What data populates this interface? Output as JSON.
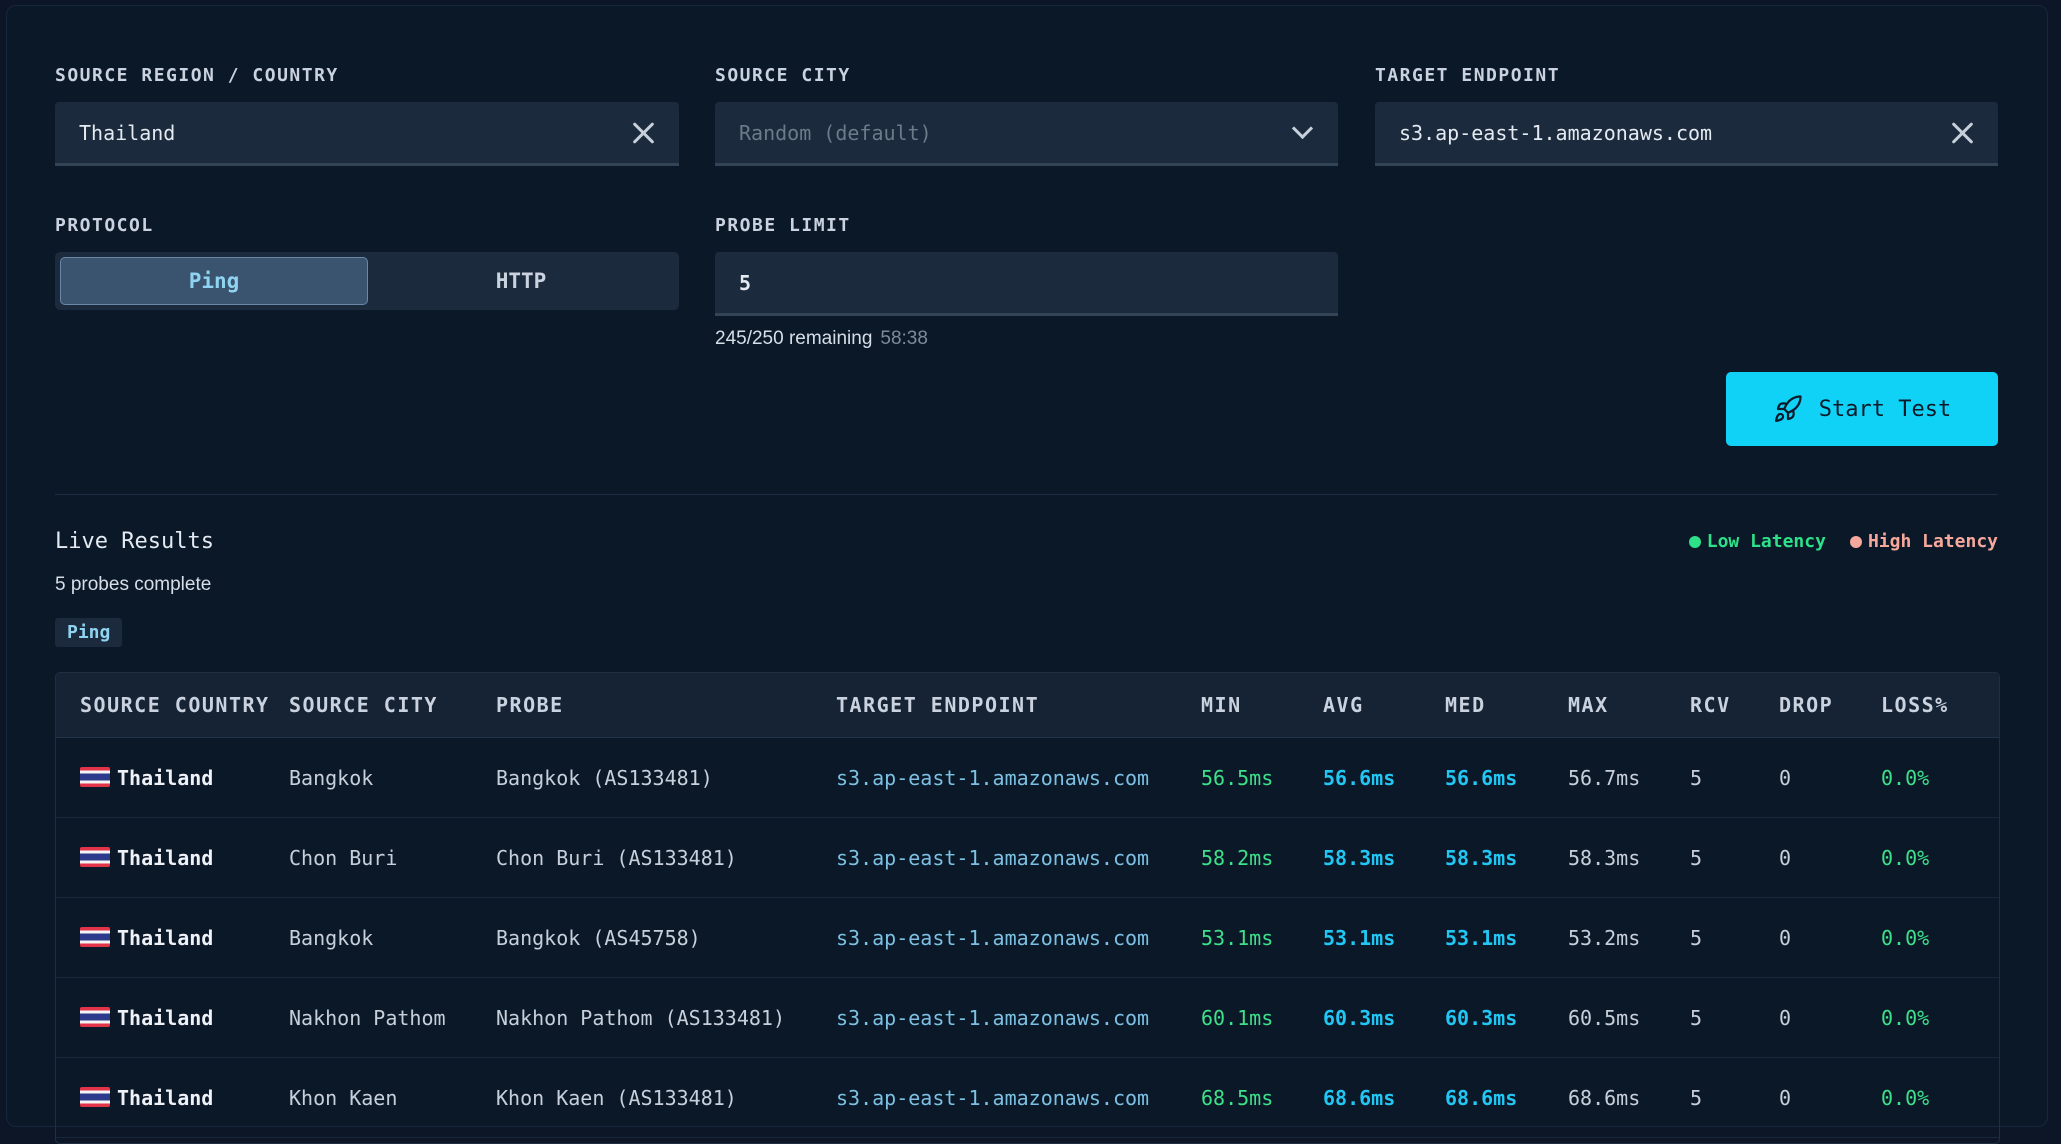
{
  "form": {
    "source_region_label": "SOURCE REGION / COUNTRY",
    "source_region_value": "Thailand",
    "source_city_label": "SOURCE CITY",
    "source_city_placeholder": "Random (default)",
    "target_label": "TARGET ENDPOINT",
    "target_value": "s3.ap-east-1.amazonaws.com",
    "protocol_label": "PROTOCOL",
    "protocol_options": [
      "Ping",
      "HTTP"
    ],
    "protocol_selected": "Ping",
    "probe_limit_label": "PROBE LIMIT",
    "probe_limit_value": "5",
    "quota_text": "245/250 remaining",
    "quota_timer": "58:38",
    "start_label": "Start Test"
  },
  "results": {
    "title": "Live Results",
    "subtitle": "5 probes complete",
    "protocol_pill": "Ping",
    "legend": [
      {
        "label": "Low Latency",
        "color": "#2ee08a"
      },
      {
        "label": "High Latency",
        "color": "#f7a89c"
      }
    ],
    "columns": [
      "SOURCE COUNTRY",
      "SOURCE CITY",
      "PROBE",
      "TARGET ENDPOINT",
      "MIN",
      "AVG",
      "MED",
      "MAX",
      "RCV",
      "DROP",
      "LOSS%"
    ],
    "rows": [
      {
        "country": "Thailand",
        "city": "Bangkok",
        "probe": "Bangkok (AS133481)",
        "target": "s3.ap-east-1.amazonaws.com",
        "min": "56.5ms",
        "avg": "56.6ms",
        "med": "56.6ms",
        "max": "56.7ms",
        "rcv": "5",
        "drop": "0",
        "loss": "0.0%"
      },
      {
        "country": "Thailand",
        "city": "Chon Buri",
        "probe": "Chon Buri (AS133481)",
        "target": "s3.ap-east-1.amazonaws.com",
        "min": "58.2ms",
        "avg": "58.3ms",
        "med": "58.3ms",
        "max": "58.3ms",
        "rcv": "5",
        "drop": "0",
        "loss": "0.0%"
      },
      {
        "country": "Thailand",
        "city": "Bangkok",
        "probe": "Bangkok (AS45758)",
        "target": "s3.ap-east-1.amazonaws.com",
        "min": "53.1ms",
        "avg": "53.1ms",
        "med": "53.1ms",
        "max": "53.2ms",
        "rcv": "5",
        "drop": "0",
        "loss": "0.0%"
      },
      {
        "country": "Thailand",
        "city": "Nakhon Pathom",
        "probe": "Nakhon Pathom (AS133481)",
        "target": "s3.ap-east-1.amazonaws.com",
        "min": "60.1ms",
        "avg": "60.3ms",
        "med": "60.3ms",
        "max": "60.5ms",
        "rcv": "5",
        "drop": "0",
        "loss": "0.0%"
      },
      {
        "country": "Thailand",
        "city": "Khon Kaen",
        "probe": "Khon Kaen (AS133481)",
        "target": "s3.ap-east-1.amazonaws.com",
        "min": "68.5ms",
        "avg": "68.6ms",
        "med": "68.6ms",
        "max": "68.6ms",
        "rcv": "5",
        "drop": "0",
        "loss": "0.0%"
      }
    ]
  }
}
